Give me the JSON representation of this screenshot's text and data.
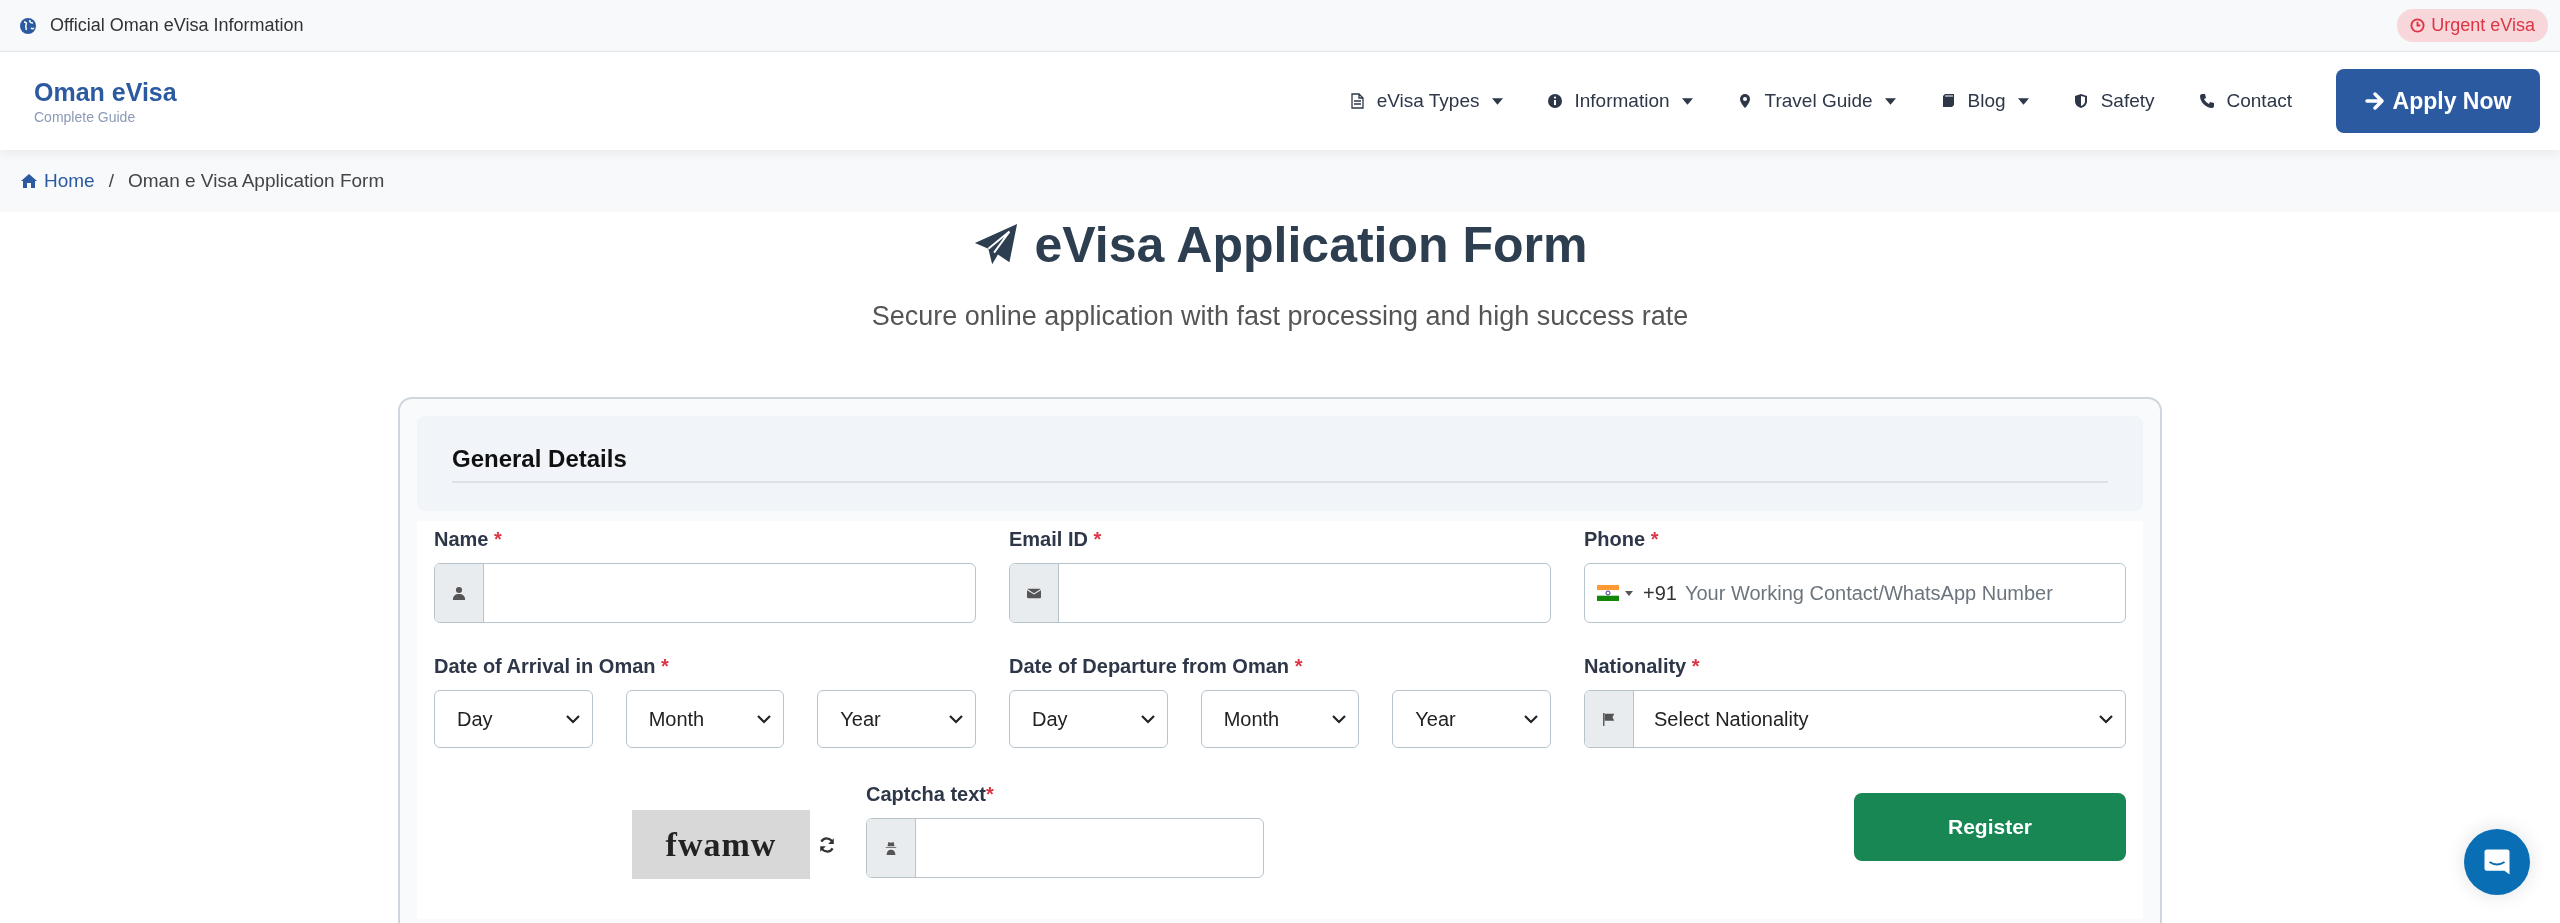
{
  "topbar": {
    "text": "Official Oman eVisa Information",
    "badge": "Urgent eVisa"
  },
  "logo": {
    "title": "Oman eVisa",
    "subtitle": "Complete Guide"
  },
  "nav": [
    {
      "label": "eVisa Types",
      "dropdown": true
    },
    {
      "label": "Information",
      "dropdown": true
    },
    {
      "label": "Travel Guide",
      "dropdown": true
    },
    {
      "label": "Blog",
      "dropdown": true
    },
    {
      "label": "Safety",
      "dropdown": false
    },
    {
      "label": "Contact",
      "dropdown": false
    }
  ],
  "apply_button": "Apply Now",
  "breadcrumb": {
    "items": [
      "Home",
      "Oman e Visa Application Form"
    ],
    "separator": "/"
  },
  "page_title": "eVisa Application Form",
  "subtitle": "Secure online application with fast processing and high success rate",
  "form": {
    "section_title": "General Details",
    "fields": [
      {
        "kind": "text",
        "label": "Name",
        "mark": "*"
      },
      {
        "kind": "email",
        "label": "Email ID",
        "mark": "*"
      },
      {
        "kind": "phone",
        "label": "Phone",
        "mark": "*",
        "dial_code": "+91",
        "placeholder": "Your Working Contact/WhatsApp Number"
      },
      {
        "kind": "date",
        "label": "Date of Arrival in Oman",
        "mark": "*",
        "selects": [
          "Day",
          "Month",
          "Year"
        ]
      },
      {
        "kind": "date",
        "label": "Date of Departure from Oman",
        "mark": "*",
        "selects": [
          "Day",
          "Month",
          "Year"
        ]
      },
      {
        "kind": "select",
        "label": "Nationality",
        "mark": "*",
        "value": "Select Nationality"
      }
    ],
    "captcha": {
      "image_text": "fwamw",
      "label": "Captcha text",
      "mark": "*"
    },
    "register_button": "Register"
  }
}
